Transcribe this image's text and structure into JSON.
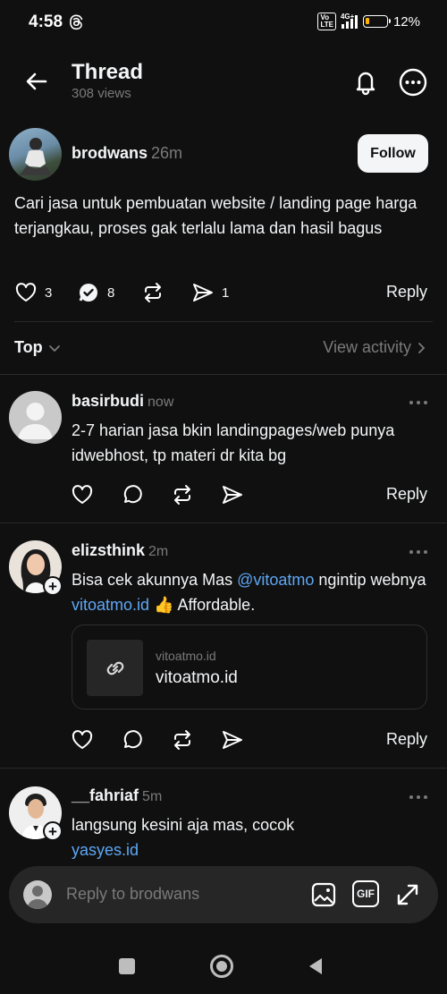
{
  "status_bar": {
    "time": "4:58",
    "battery": "12%",
    "network": "4G+",
    "volte": "Vo\nLTE"
  },
  "header": {
    "title": "Thread",
    "views": "308 views"
  },
  "post": {
    "author": "brodwans",
    "time": "26m",
    "follow_label": "Follow",
    "text": "Cari jasa untuk pembuatan website / landing page harga terjangkau, proses gak terlalu lama dan hasil bagus",
    "likes": "3",
    "comments": "8",
    "shares": "1",
    "reply_label": "Reply"
  },
  "sort": {
    "label": "Top",
    "view_activity": "View activity"
  },
  "comments": [
    {
      "author": "basirbudi",
      "time": "now",
      "text": "2-7 harian jasa bkin landingpages/web  punya idwebhost, tp materi dr kita bg",
      "reply_label": "Reply"
    },
    {
      "author": "elizsthink",
      "time": "2m",
      "text_before": "Bisa cek akunnya Mas ",
      "mention": "@vitoatmo",
      "text_mid": " ngintip webnya ",
      "link": "vitoatmo.id",
      "text_after": " 👍 Affordable.",
      "card_domain": "vitoatmo.id",
      "card_title": "vitoatmo.id",
      "reply_label": "Reply"
    },
    {
      "author": "__fahriaf",
      "time": "5m",
      "text": "langsung kesini aja mas, cocok",
      "link": "yasyes.id"
    }
  ],
  "composer": {
    "placeholder": "Reply to brodwans",
    "gif_label": "GIF"
  }
}
